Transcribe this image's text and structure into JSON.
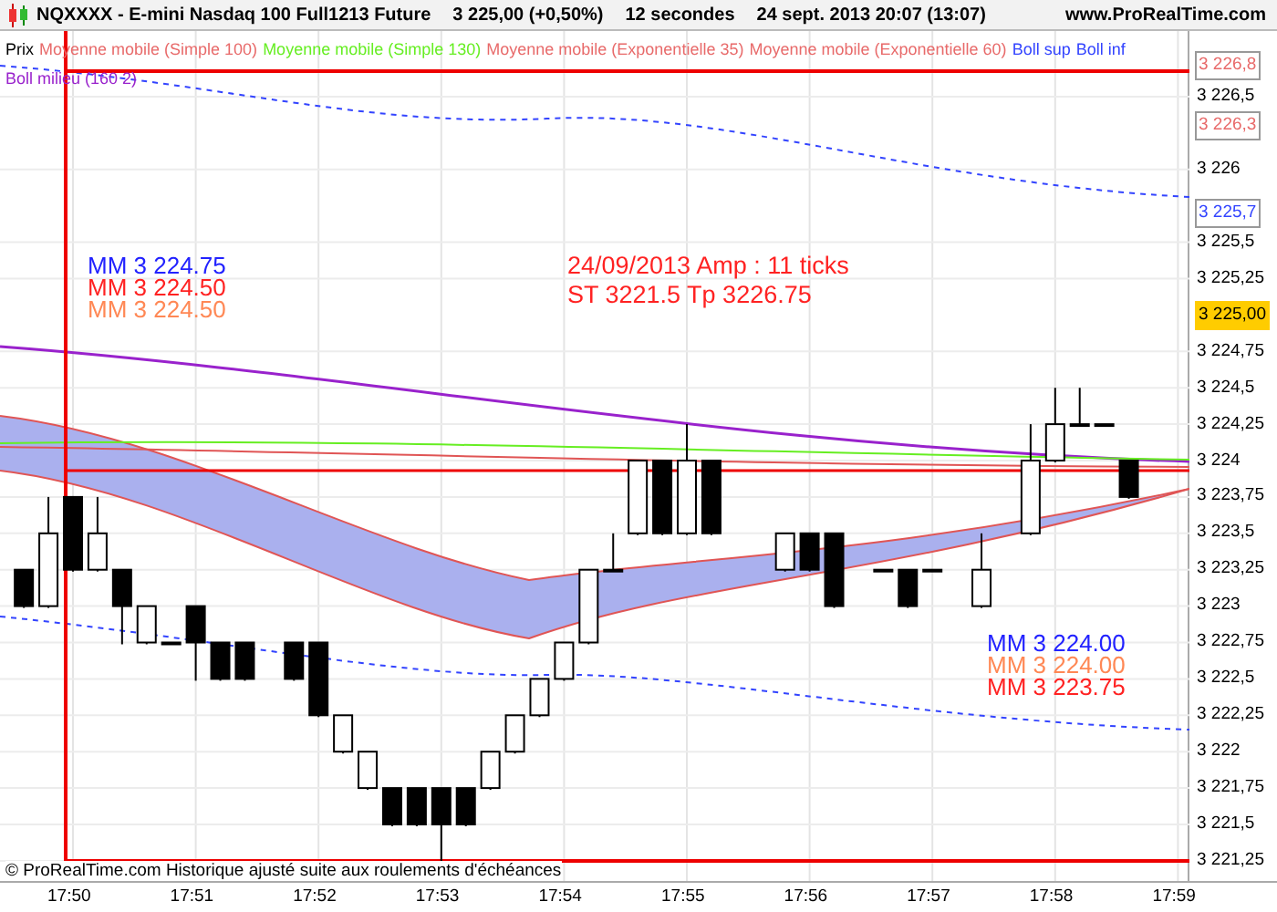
{
  "header": {
    "title": "NQXXXX - E-mini Nasdaq 100 Full1213 Future",
    "price": "3 225,00 (+0,50%)",
    "interval": "12 secondes",
    "datetime": "24 sept. 2013 20:07 (13:07)",
    "website": "www.ProRealTime.com"
  },
  "legend": [
    {
      "label": "Prix",
      "color": "#000000"
    },
    {
      "label": "Moyenne mobile (Simple 100)",
      "color": "#e86a6a"
    },
    {
      "label": "Moyenne mobile (Simple 130)",
      "color": "#66ee22"
    },
    {
      "label": "Moyenne mobile (Exponentielle 35)",
      "color": "#e86a6a"
    },
    {
      "label": "Moyenne mobile (Exponentielle 60)",
      "color": "#e86a6a"
    },
    {
      "label": "Boll sup",
      "color": "#3344ff"
    },
    {
      "label": "Boll inf",
      "color": "#3344ff"
    },
    {
      "label": "Boll milieu (160 2)",
      "color": "#9922cc"
    }
  ],
  "left_labels": [
    {
      "text": "MM 3 224.75",
      "color": "#2222ff"
    },
    {
      "text": "MM 3 224.50",
      "color": "#ff2222"
    },
    {
      "text": "MM 3 224.50",
      "color": "#ff8855"
    }
  ],
  "note": [
    "24/09/2013  Amp : 11 ticks",
    "ST 3221.5  Tp 3226.75"
  ],
  "right_labels": [
    {
      "text": "MM 3 224.00",
      "color": "#2222ff"
    },
    {
      "text": "MM 3 224.00",
      "color": "#ff8855"
    },
    {
      "text": "MM 3 223.75",
      "color": "#ff2222"
    }
  ],
  "footer": "© ProRealTime.com Historique ajusté suite aux roulements d'échéances",
  "price_axis": {
    "ticks": [
      "3 226,5",
      "3 226",
      "3 225,5",
      "3 225,25",
      "3 224,75",
      "3 224,5",
      "3 224,25",
      "3 224",
      "3 223,75",
      "3 223,5",
      "3 223,25",
      "3 223",
      "3 222,75",
      "3 222,5",
      "3 222,25",
      "3 222",
      "3 221,75",
      "3 221,5",
      "3 221,25"
    ],
    "markers": [
      {
        "text": "3 226,8",
        "kind": "level",
        "color": "#e86a6a"
      },
      {
        "text": "3 226,3",
        "kind": "level",
        "color": "#e86a6a"
      },
      {
        "text": "3 225,7",
        "kind": "level",
        "color": "#3344ff"
      },
      {
        "text": "3 225,00",
        "kind": "current"
      }
    ]
  },
  "time_axis": [
    "17:50",
    "17:51",
    "17:52",
    "17:53",
    "17:54",
    "17:55",
    "17:56",
    "17:57",
    "17:58",
    "17:59"
  ]
}
